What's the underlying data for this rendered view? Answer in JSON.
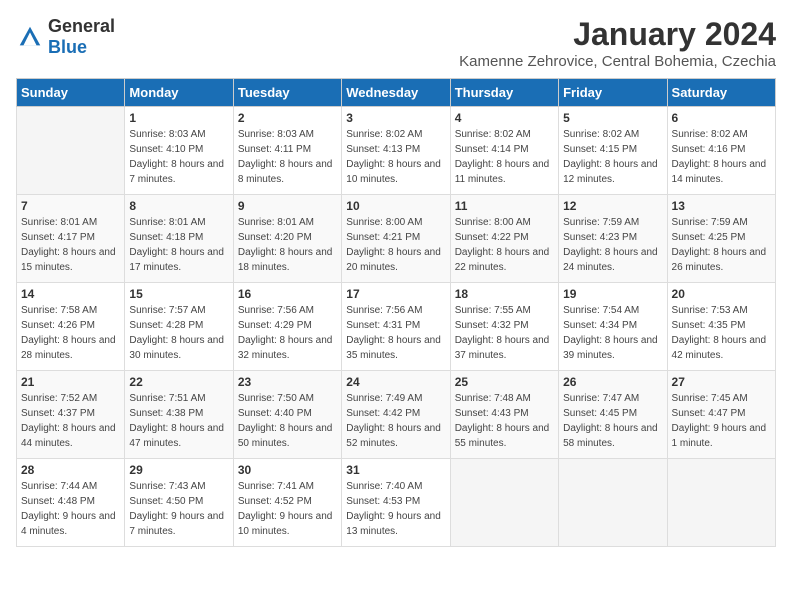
{
  "logo": {
    "general": "General",
    "blue": "Blue"
  },
  "title": "January 2024",
  "subtitle": "Kamenne Zehrovice, Central Bohemia, Czechia",
  "weekdays": [
    "Sunday",
    "Monday",
    "Tuesday",
    "Wednesday",
    "Thursday",
    "Friday",
    "Saturday"
  ],
  "weeks": [
    [
      {
        "num": "",
        "sunrise": "",
        "sunset": "",
        "daylight": ""
      },
      {
        "num": "1",
        "sunrise": "Sunrise: 8:03 AM",
        "sunset": "Sunset: 4:10 PM",
        "daylight": "Daylight: 8 hours and 7 minutes."
      },
      {
        "num": "2",
        "sunrise": "Sunrise: 8:03 AM",
        "sunset": "Sunset: 4:11 PM",
        "daylight": "Daylight: 8 hours and 8 minutes."
      },
      {
        "num": "3",
        "sunrise": "Sunrise: 8:02 AM",
        "sunset": "Sunset: 4:13 PM",
        "daylight": "Daylight: 8 hours and 10 minutes."
      },
      {
        "num": "4",
        "sunrise": "Sunrise: 8:02 AM",
        "sunset": "Sunset: 4:14 PM",
        "daylight": "Daylight: 8 hours and 11 minutes."
      },
      {
        "num": "5",
        "sunrise": "Sunrise: 8:02 AM",
        "sunset": "Sunset: 4:15 PM",
        "daylight": "Daylight: 8 hours and 12 minutes."
      },
      {
        "num": "6",
        "sunrise": "Sunrise: 8:02 AM",
        "sunset": "Sunset: 4:16 PM",
        "daylight": "Daylight: 8 hours and 14 minutes."
      }
    ],
    [
      {
        "num": "7",
        "sunrise": "Sunrise: 8:01 AM",
        "sunset": "Sunset: 4:17 PM",
        "daylight": "Daylight: 8 hours and 15 minutes."
      },
      {
        "num": "8",
        "sunrise": "Sunrise: 8:01 AM",
        "sunset": "Sunset: 4:18 PM",
        "daylight": "Daylight: 8 hours and 17 minutes."
      },
      {
        "num": "9",
        "sunrise": "Sunrise: 8:01 AM",
        "sunset": "Sunset: 4:20 PM",
        "daylight": "Daylight: 8 hours and 18 minutes."
      },
      {
        "num": "10",
        "sunrise": "Sunrise: 8:00 AM",
        "sunset": "Sunset: 4:21 PM",
        "daylight": "Daylight: 8 hours and 20 minutes."
      },
      {
        "num": "11",
        "sunrise": "Sunrise: 8:00 AM",
        "sunset": "Sunset: 4:22 PM",
        "daylight": "Daylight: 8 hours and 22 minutes."
      },
      {
        "num": "12",
        "sunrise": "Sunrise: 7:59 AM",
        "sunset": "Sunset: 4:23 PM",
        "daylight": "Daylight: 8 hours and 24 minutes."
      },
      {
        "num": "13",
        "sunrise": "Sunrise: 7:59 AM",
        "sunset": "Sunset: 4:25 PM",
        "daylight": "Daylight: 8 hours and 26 minutes."
      }
    ],
    [
      {
        "num": "14",
        "sunrise": "Sunrise: 7:58 AM",
        "sunset": "Sunset: 4:26 PM",
        "daylight": "Daylight: 8 hours and 28 minutes."
      },
      {
        "num": "15",
        "sunrise": "Sunrise: 7:57 AM",
        "sunset": "Sunset: 4:28 PM",
        "daylight": "Daylight: 8 hours and 30 minutes."
      },
      {
        "num": "16",
        "sunrise": "Sunrise: 7:56 AM",
        "sunset": "Sunset: 4:29 PM",
        "daylight": "Daylight: 8 hours and 32 minutes."
      },
      {
        "num": "17",
        "sunrise": "Sunrise: 7:56 AM",
        "sunset": "Sunset: 4:31 PM",
        "daylight": "Daylight: 8 hours and 35 minutes."
      },
      {
        "num": "18",
        "sunrise": "Sunrise: 7:55 AM",
        "sunset": "Sunset: 4:32 PM",
        "daylight": "Daylight: 8 hours and 37 minutes."
      },
      {
        "num": "19",
        "sunrise": "Sunrise: 7:54 AM",
        "sunset": "Sunset: 4:34 PM",
        "daylight": "Daylight: 8 hours and 39 minutes."
      },
      {
        "num": "20",
        "sunrise": "Sunrise: 7:53 AM",
        "sunset": "Sunset: 4:35 PM",
        "daylight": "Daylight: 8 hours and 42 minutes."
      }
    ],
    [
      {
        "num": "21",
        "sunrise": "Sunrise: 7:52 AM",
        "sunset": "Sunset: 4:37 PM",
        "daylight": "Daylight: 8 hours and 44 minutes."
      },
      {
        "num": "22",
        "sunrise": "Sunrise: 7:51 AM",
        "sunset": "Sunset: 4:38 PM",
        "daylight": "Daylight: 8 hours and 47 minutes."
      },
      {
        "num": "23",
        "sunrise": "Sunrise: 7:50 AM",
        "sunset": "Sunset: 4:40 PM",
        "daylight": "Daylight: 8 hours and 50 minutes."
      },
      {
        "num": "24",
        "sunrise": "Sunrise: 7:49 AM",
        "sunset": "Sunset: 4:42 PM",
        "daylight": "Daylight: 8 hours and 52 minutes."
      },
      {
        "num": "25",
        "sunrise": "Sunrise: 7:48 AM",
        "sunset": "Sunset: 4:43 PM",
        "daylight": "Daylight: 8 hours and 55 minutes."
      },
      {
        "num": "26",
        "sunrise": "Sunrise: 7:47 AM",
        "sunset": "Sunset: 4:45 PM",
        "daylight": "Daylight: 8 hours and 58 minutes."
      },
      {
        "num": "27",
        "sunrise": "Sunrise: 7:45 AM",
        "sunset": "Sunset: 4:47 PM",
        "daylight": "Daylight: 9 hours and 1 minute."
      }
    ],
    [
      {
        "num": "28",
        "sunrise": "Sunrise: 7:44 AM",
        "sunset": "Sunset: 4:48 PM",
        "daylight": "Daylight: 9 hours and 4 minutes."
      },
      {
        "num": "29",
        "sunrise": "Sunrise: 7:43 AM",
        "sunset": "Sunset: 4:50 PM",
        "daylight": "Daylight: 9 hours and 7 minutes."
      },
      {
        "num": "30",
        "sunrise": "Sunrise: 7:41 AM",
        "sunset": "Sunset: 4:52 PM",
        "daylight": "Daylight: 9 hours and 10 minutes."
      },
      {
        "num": "31",
        "sunrise": "Sunrise: 7:40 AM",
        "sunset": "Sunset: 4:53 PM",
        "daylight": "Daylight: 9 hours and 13 minutes."
      },
      {
        "num": "",
        "sunrise": "",
        "sunset": "",
        "daylight": ""
      },
      {
        "num": "",
        "sunrise": "",
        "sunset": "",
        "daylight": ""
      },
      {
        "num": "",
        "sunrise": "",
        "sunset": "",
        "daylight": ""
      }
    ]
  ]
}
